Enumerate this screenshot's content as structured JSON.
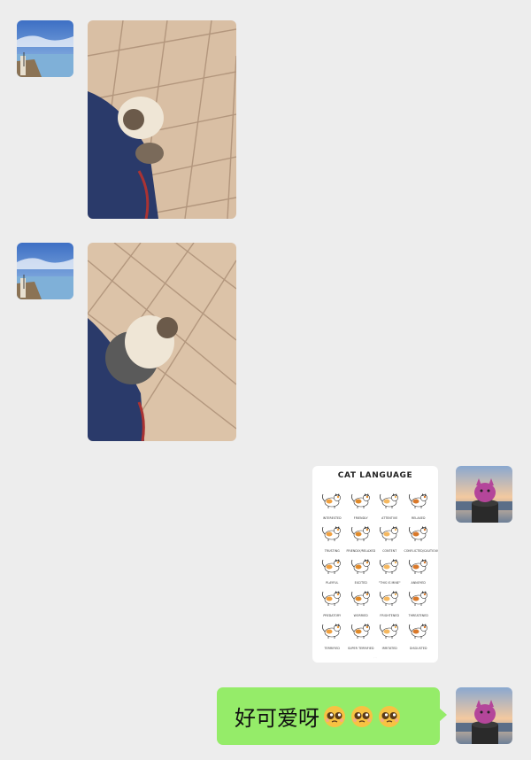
{
  "colors": {
    "background": "#ededed",
    "outgoing_bubble": "#95ec69"
  },
  "messages": [
    {
      "side": "incoming",
      "type": "image",
      "subject": "cat-on-tile-floor-photo"
    },
    {
      "side": "incoming",
      "type": "image",
      "subject": "cat-on-tile-floor-photo"
    },
    {
      "side": "outgoing",
      "type": "image",
      "subject": "cat-language-poster",
      "poster": {
        "title": "CAT LANGUAGE",
        "labels": [
          "INTERESTED",
          "FRIENDLY",
          "ATTENTIVE",
          "RELAXED",
          "TRUSTING",
          "FRIENDLY/RELAXED",
          "CONTENT",
          "CONFLICTED/CAUTIOUS",
          "PLAYFUL",
          "EXCITED",
          "\"THIS IS MINE\"",
          "ANNOYED",
          "PREDATORY",
          "WORRIED",
          "FRIGHTENED",
          "THREATENED",
          "TERRIFIED",
          "SUPER TERRIFIED",
          "IRRITATED",
          "DISGUSTED"
        ]
      }
    },
    {
      "side": "outgoing",
      "type": "text",
      "text": "好可爱呀",
      "emojis": [
        "pleading-face-emoji",
        "pleading-face-emoji",
        "pleading-face-emoji"
      ]
    }
  ]
}
